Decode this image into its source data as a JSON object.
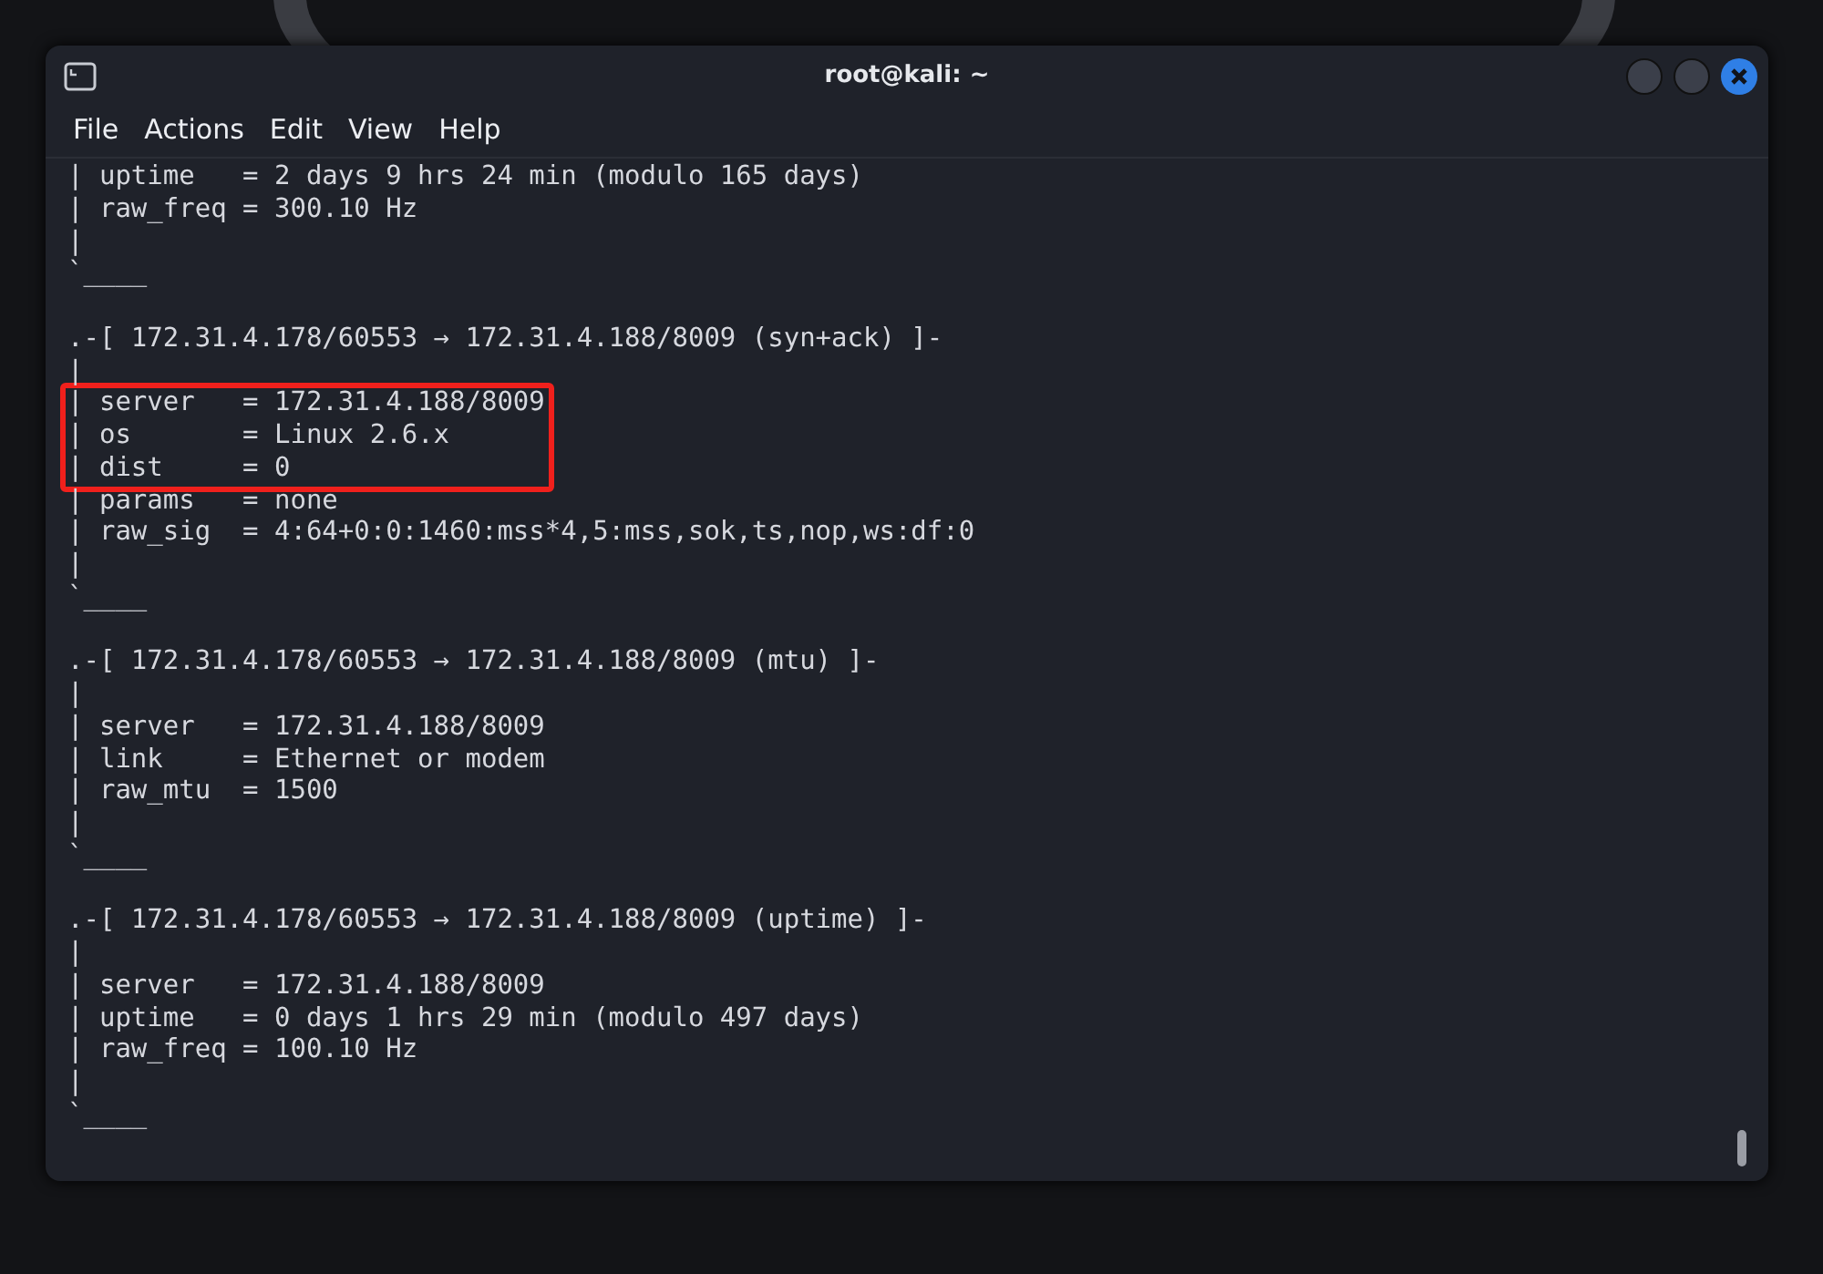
{
  "window": {
    "title": "root@kali: ~"
  },
  "menu": [
    "File",
    "Actions",
    "Edit",
    "View",
    "Help"
  ],
  "lines": [
    {
      "kind": "text",
      "text": "| uptime   = 2 days 9 hrs 24 min (modulo 165 days)",
      "highlighted": false
    },
    {
      "kind": "text",
      "text": "| raw_freq = 300.10 Hz",
      "highlighted": false
    },
    {
      "kind": "text",
      "text": "|",
      "highlighted": false
    },
    {
      "kind": "text",
      "text": "`____",
      "highlighted": false
    },
    {
      "kind": "blank"
    },
    {
      "kind": "text",
      "text": ".-[ 172.31.4.178/60553 → 172.31.4.188/8009 (syn+ack) ]-",
      "highlighted": false
    },
    {
      "kind": "text",
      "text": "|",
      "highlighted": false
    },
    {
      "kind": "text",
      "text": "| server   = 172.31.4.188/8009",
      "highlighted": true
    },
    {
      "kind": "text",
      "text": "| os       = Linux 2.6.x",
      "highlighted": true
    },
    {
      "kind": "text",
      "text": "| dist     = 0",
      "highlighted": true
    },
    {
      "kind": "text",
      "text": "| params   = none",
      "highlighted": false
    },
    {
      "kind": "text",
      "text": "| raw_sig  = 4:64+0:0:1460:mss*4,5:mss,sok,ts,nop,ws:df:0",
      "highlighted": false
    },
    {
      "kind": "text",
      "text": "|",
      "highlighted": false
    },
    {
      "kind": "text",
      "text": "`____",
      "highlighted": false
    },
    {
      "kind": "blank"
    },
    {
      "kind": "text",
      "text": ".-[ 172.31.4.178/60553 → 172.31.4.188/8009 (mtu) ]-",
      "highlighted": false
    },
    {
      "kind": "text",
      "text": "|",
      "highlighted": false
    },
    {
      "kind": "text",
      "text": "| server   = 172.31.4.188/8009",
      "highlighted": false
    },
    {
      "kind": "text",
      "text": "| link     = Ethernet or modem",
      "highlighted": false
    },
    {
      "kind": "text",
      "text": "| raw_mtu  = 1500",
      "highlighted": false
    },
    {
      "kind": "text",
      "text": "|",
      "highlighted": false
    },
    {
      "kind": "text",
      "text": "`____",
      "highlighted": false
    },
    {
      "kind": "blank"
    },
    {
      "kind": "text",
      "text": ".-[ 172.31.4.178/60553 → 172.31.4.188/8009 (uptime) ]-",
      "highlighted": false
    },
    {
      "kind": "text",
      "text": "|",
      "highlighted": false
    },
    {
      "kind": "text",
      "text": "| server   = 172.31.4.188/8009",
      "highlighted": false
    },
    {
      "kind": "text",
      "text": "| uptime   = 0 days 1 hrs 29 min (modulo 497 days)",
      "highlighted": false
    },
    {
      "kind": "text",
      "text": "| raw_freq = 100.10 Hz",
      "highlighted": false
    },
    {
      "kind": "text",
      "text": "|",
      "highlighted": false
    },
    {
      "kind": "text",
      "text": "`____",
      "highlighted": false
    }
  ]
}
